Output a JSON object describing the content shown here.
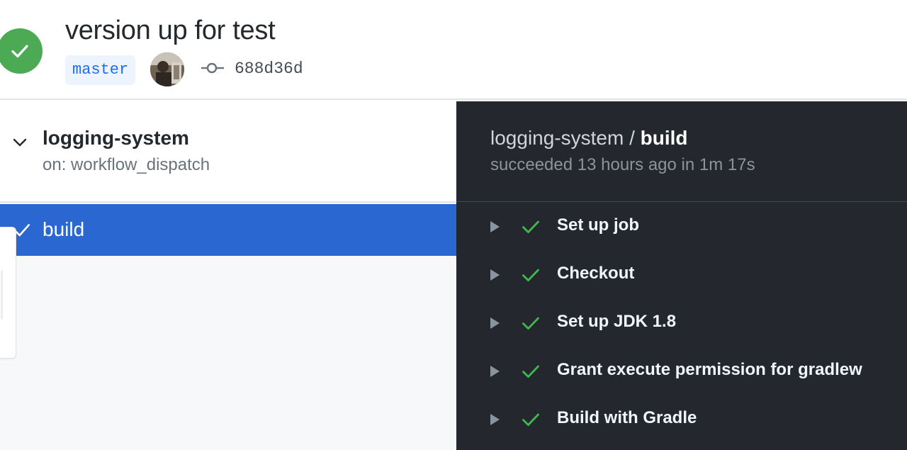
{
  "header": {
    "commit_title": "version up for test",
    "branch": "master",
    "commit_sha": "688d36d",
    "status": "success"
  },
  "workflow": {
    "name": "logging-system",
    "trigger": "on: workflow_dispatch"
  },
  "jobs": [
    {
      "name": "build",
      "status": "success",
      "selected": true
    }
  ],
  "job_detail": {
    "workflow_name": "logging-system",
    "separator": " / ",
    "job_name": "build",
    "meta": "succeeded 13 hours ago in 1m 17s"
  },
  "steps": [
    {
      "label": "Set up job",
      "status": "success"
    },
    {
      "label": "Checkout",
      "status": "success"
    },
    {
      "label": "Set up JDK 1.8",
      "status": "success"
    },
    {
      "label": "Grant execute permission for gradlew",
      "status": "success"
    },
    {
      "label": "Build with Gradle",
      "status": "success"
    }
  ],
  "colors": {
    "success_green": "#4caa55",
    "step_check_green": "#3fb950",
    "selected_blue": "#2a67d1",
    "dark_panel": "#24272d",
    "branch_text": "#1f6feb"
  }
}
